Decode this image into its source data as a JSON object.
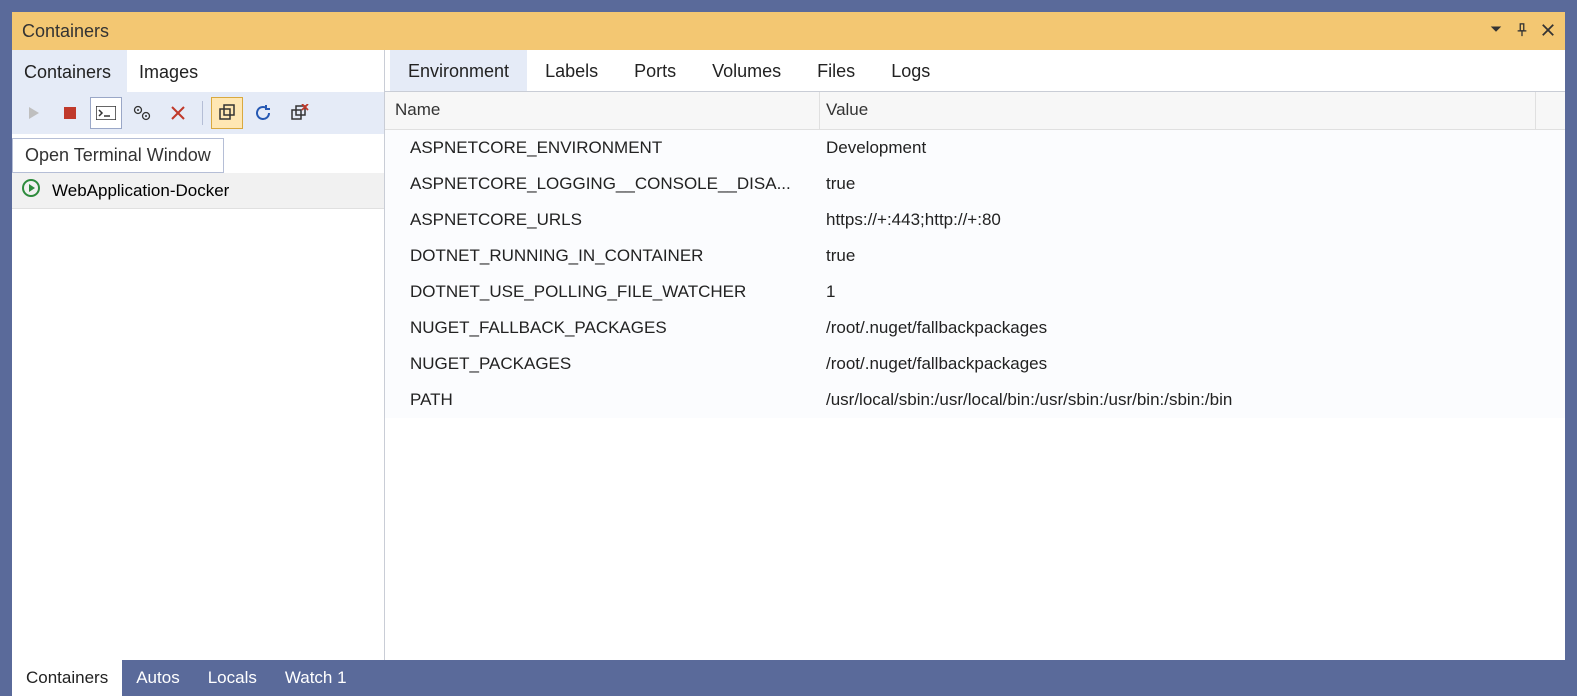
{
  "titlebar": {
    "title": "Containers"
  },
  "left_tabs": [
    {
      "label": "Containers",
      "active": true
    },
    {
      "label": "Images",
      "active": false
    }
  ],
  "tooltip": "Open Terminal Window",
  "containers": [
    {
      "name": "WebApplication-Docker",
      "running": true
    }
  ],
  "right_tabs": [
    {
      "label": "Environment",
      "active": true
    },
    {
      "label": "Labels",
      "active": false
    },
    {
      "label": "Ports",
      "active": false
    },
    {
      "label": "Volumes",
      "active": false
    },
    {
      "label": "Files",
      "active": false
    },
    {
      "label": "Logs",
      "active": false
    }
  ],
  "grid": {
    "columns": [
      "Name",
      "Value"
    ],
    "rows": [
      {
        "name": "ASPNETCORE_ENVIRONMENT",
        "value": "Development"
      },
      {
        "name": "ASPNETCORE_LOGGING__CONSOLE__DISA...",
        "value": "true"
      },
      {
        "name": "ASPNETCORE_URLS",
        "value": "https://+:443;http://+:80"
      },
      {
        "name": "DOTNET_RUNNING_IN_CONTAINER",
        "value": "true"
      },
      {
        "name": "DOTNET_USE_POLLING_FILE_WATCHER",
        "value": "1"
      },
      {
        "name": "NUGET_FALLBACK_PACKAGES",
        "value": "/root/.nuget/fallbackpackages"
      },
      {
        "name": "NUGET_PACKAGES",
        "value": "/root/.nuget/fallbackpackages"
      },
      {
        "name": "PATH",
        "value": "/usr/local/sbin:/usr/local/bin:/usr/sbin:/usr/bin:/sbin:/bin"
      }
    ]
  },
  "bottom_tabs": [
    {
      "label": "Containers",
      "active": true
    },
    {
      "label": "Autos",
      "active": false
    },
    {
      "label": "Locals",
      "active": false
    },
    {
      "label": "Watch 1",
      "active": false
    }
  ]
}
